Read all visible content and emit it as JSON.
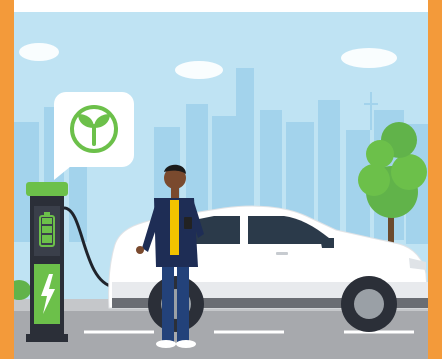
{
  "scene": {
    "subject": "ev-charging-illustration",
    "colors": {
      "frame": "#f39a3a",
      "sky": "#bfe3f3",
      "skyline": "#9fd0ea",
      "ground": "#a7a9ad",
      "road_lines": "#ffffff",
      "charger_body": "#2b2f38",
      "charger_accent": "#6cc04a",
      "car_body": "#ffffff",
      "car_window": "#2b3a4a",
      "tree": "#61b34a",
      "person_jacket": "#1e2d55",
      "person_shirt": "#f2c300",
      "person_jeans": "#23427a",
      "leaf_badge": "#6cc04a"
    },
    "icons": [
      "leaf-icon",
      "battery-icon",
      "lightning-icon"
    ]
  }
}
